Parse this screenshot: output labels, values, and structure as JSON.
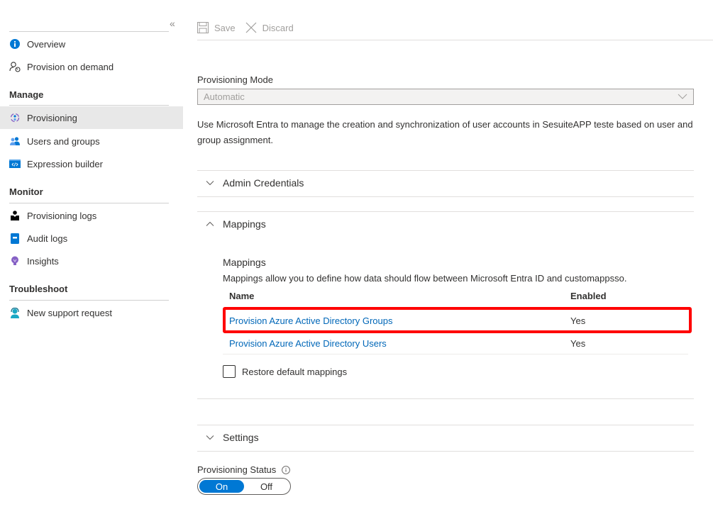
{
  "sidebar": {
    "collapse_label": "«",
    "items_top": [
      {
        "label": "Overview",
        "icon": "info-icon"
      },
      {
        "label": "Provision on demand",
        "icon": "user-sync-icon"
      }
    ],
    "sections": [
      {
        "title": "Manage",
        "items": [
          {
            "label": "Provisioning",
            "icon": "provisioning-icon",
            "selected": true
          },
          {
            "label": "Users and groups",
            "icon": "users-groups-icon"
          },
          {
            "label": "Expression builder",
            "icon": "expression-builder-icon"
          }
        ]
      },
      {
        "title": "Monitor",
        "items": [
          {
            "label": "Provisioning logs",
            "icon": "provisioning-logs-icon"
          },
          {
            "label": "Audit logs",
            "icon": "audit-logs-icon"
          },
          {
            "label": "Insights",
            "icon": "insights-icon"
          }
        ]
      },
      {
        "title": "Troubleshoot",
        "items": [
          {
            "label": "New support request",
            "icon": "support-icon"
          }
        ]
      }
    ]
  },
  "toolbar": {
    "save_label": "Save",
    "discard_label": "Discard"
  },
  "provisioning_mode": {
    "label": "Provisioning Mode",
    "value": "Automatic",
    "description": "Use Microsoft Entra to manage the creation and synchronization of user accounts in SesuiteAPP teste based on user and group assignment."
  },
  "sections": {
    "admin_credentials": "Admin Credentials",
    "mappings": "Mappings",
    "settings": "Settings"
  },
  "mappings": {
    "title": "Mappings",
    "description": "Mappings allow you to define how data should flow between Microsoft Entra ID and customappsso.",
    "columns": {
      "name": "Name",
      "enabled": "Enabled"
    },
    "rows": [
      {
        "name": "Provision Azure Active Directory Groups",
        "enabled": "Yes",
        "highlighted": true
      },
      {
        "name": "Provision Azure Active Directory Users",
        "enabled": "Yes"
      }
    ],
    "restore_label": "Restore default mappings",
    "restore_checked": false
  },
  "provisioning_status": {
    "label": "Provisioning Status",
    "on_label": "On",
    "off_label": "Off",
    "value": "On"
  },
  "colors": {
    "accent": "#0078d4",
    "link": "#0067b8",
    "highlight_border": "#ff0000"
  }
}
